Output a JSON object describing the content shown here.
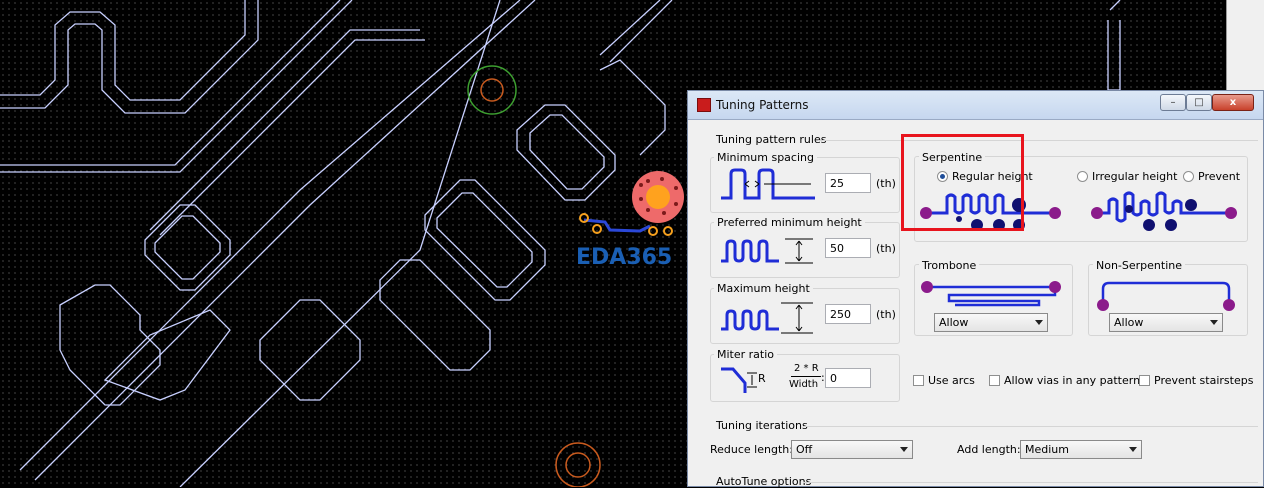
{
  "watermark": "EDA365",
  "dialog": {
    "title": "Tuning Patterns",
    "window_buttons": {
      "minimize": "–",
      "maximize": "□",
      "close": "x"
    },
    "rules_section": "Tuning pattern rules",
    "min_spacing": {
      "label": "Minimum spacing",
      "value": "25",
      "unit": "(th)"
    },
    "pref_min_height": {
      "label": "Preferred minimum height",
      "value": "50",
      "unit": "(th)"
    },
    "max_height": {
      "label": "Maximum height",
      "value": "250",
      "unit": "(th)"
    },
    "miter_ratio": {
      "label": "Miter ratio",
      "formula_top": "2 * R",
      "formula_bottom": "Width",
      "r_mark": "R",
      "value": "0"
    },
    "serpentine": {
      "label": "Serpentine",
      "options": [
        {
          "label": "Regular height",
          "selected": true
        },
        {
          "label": "Irregular height",
          "selected": false
        },
        {
          "label": "Prevent",
          "selected": false
        }
      ]
    },
    "trombone": {
      "label": "Trombone",
      "value": "Allow"
    },
    "non_serpentine": {
      "label": "Non-Serpentine",
      "value": "Allow"
    },
    "checkboxes": [
      {
        "label": "Use arcs",
        "checked": false
      },
      {
        "label": "Allow vias in any pattern",
        "checked": false
      },
      {
        "label": "Prevent stairsteps",
        "checked": false
      }
    ],
    "iterations_section": "Tuning iterations",
    "reduce_length": {
      "label": "Reduce length:",
      "value": "Off"
    },
    "add_length": {
      "label": "Add length:",
      "value": "Medium"
    },
    "autotune_section": "AutoTune options"
  }
}
